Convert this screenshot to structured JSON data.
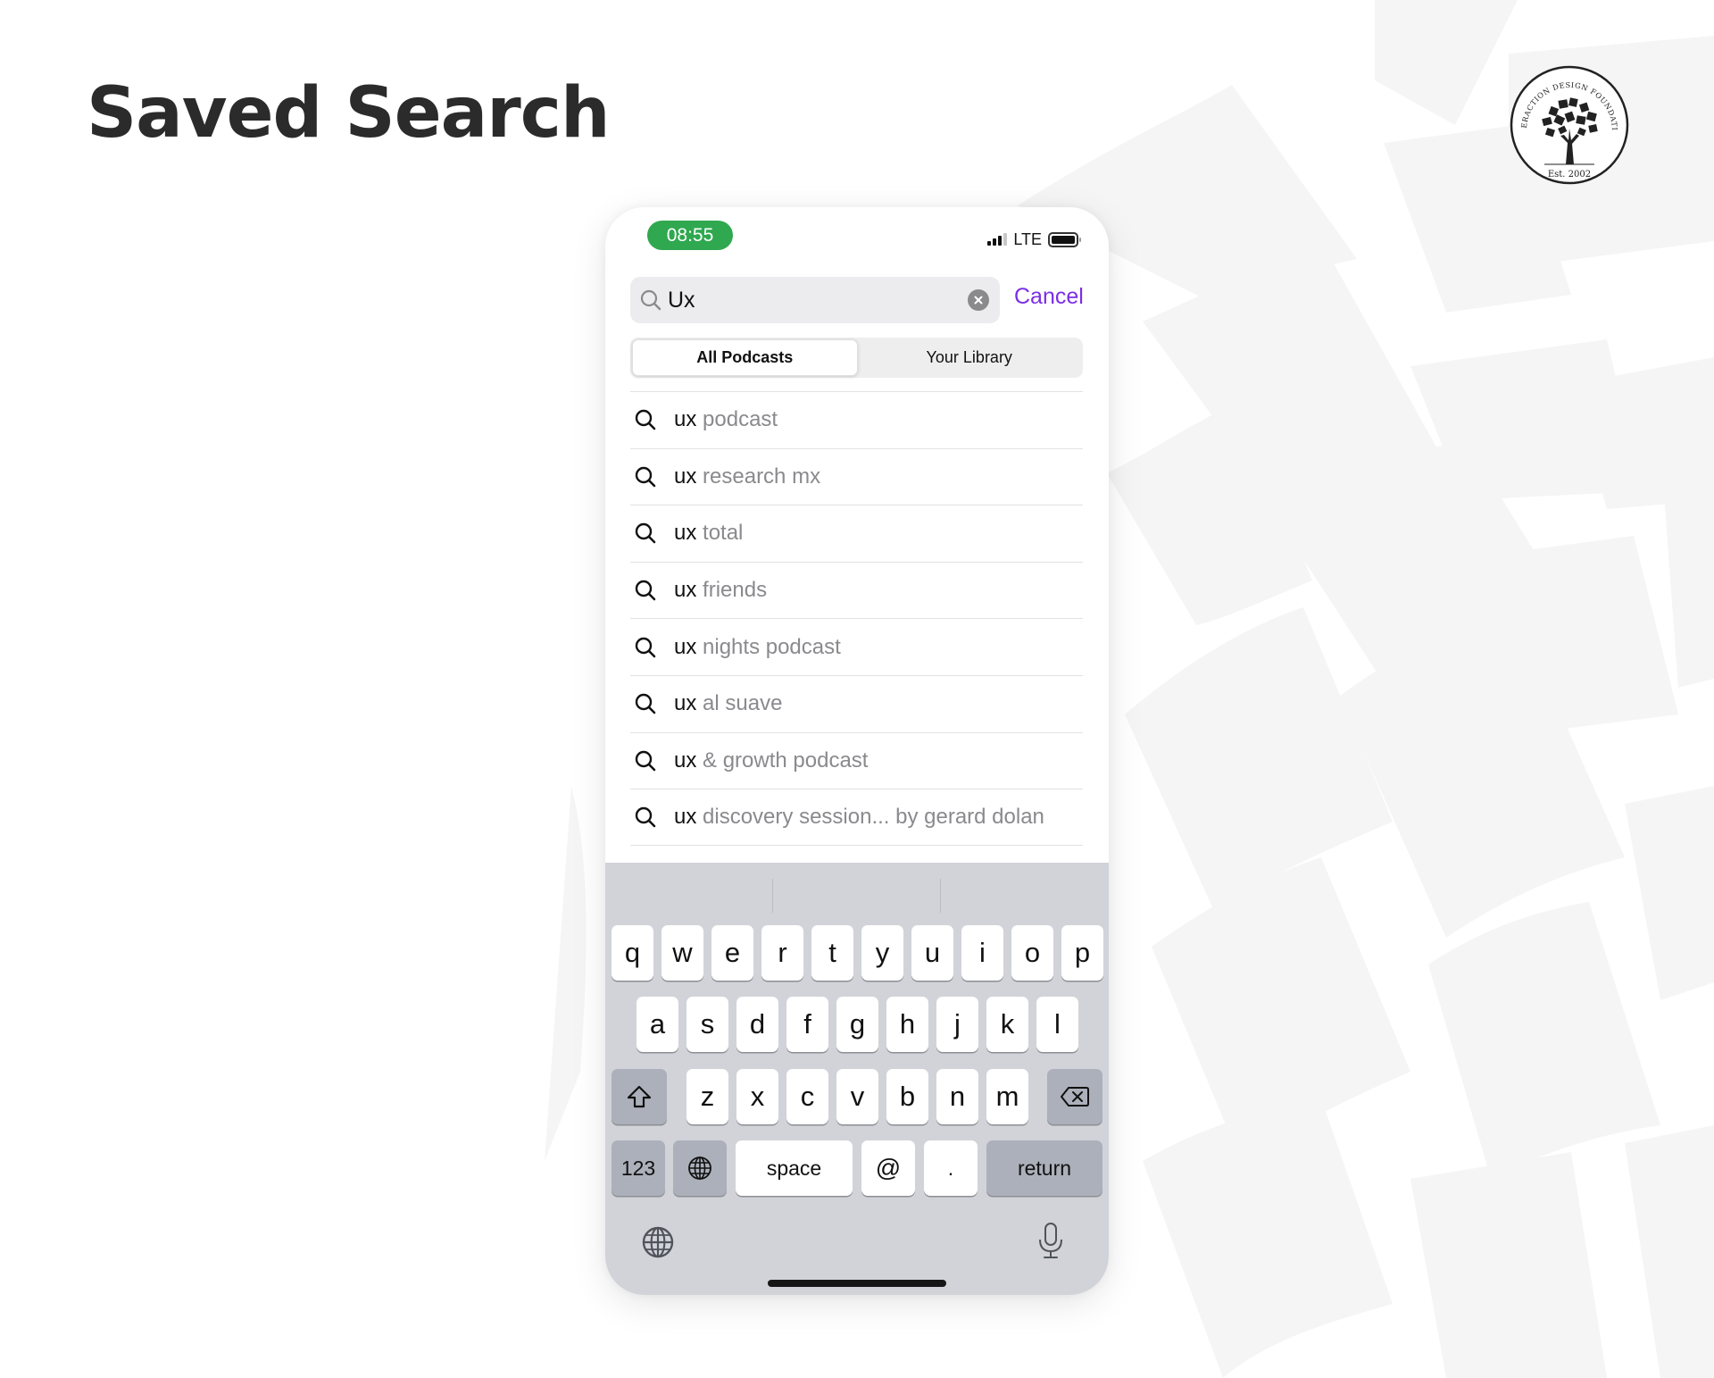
{
  "page": {
    "title": "Saved Search",
    "logo": {
      "ring_text": "INTERACTION DESIGN FOUNDATION",
      "established": "Est. 2002",
      "icon": "tree-of-books-icon"
    }
  },
  "status_bar": {
    "time": "08:55",
    "time_badge_color": "#2fa84f",
    "network": "LTE",
    "signal_bars_filled": 3,
    "signal_bars_total": 4,
    "battery_icon": "battery-icon"
  },
  "search": {
    "value": "Ux",
    "placeholder": "",
    "clear_icon": "clear-icon",
    "cancel_label": "Cancel",
    "accent_color": "#7b2ee6"
  },
  "scope": {
    "tabs": [
      {
        "label": "All Podcasts",
        "selected": true
      },
      {
        "label": "Your Library",
        "selected": false
      }
    ]
  },
  "suggestions": [
    {
      "prefix": "ux",
      "rest": " podcast"
    },
    {
      "prefix": "ux",
      "rest": " research mx"
    },
    {
      "prefix": "ux",
      "rest": " total"
    },
    {
      "prefix": "ux",
      "rest": " friends"
    },
    {
      "prefix": "ux",
      "rest": " nights podcast"
    },
    {
      "prefix": "ux",
      "rest": " al suave"
    },
    {
      "prefix": "ux",
      "rest": " & growth podcast"
    },
    {
      "prefix": "ux",
      "rest": " discovery session... by gerard dolan"
    }
  ],
  "keyboard": {
    "row1": [
      "q",
      "w",
      "e",
      "r",
      "t",
      "y",
      "u",
      "i",
      "o",
      "p"
    ],
    "row2": [
      "a",
      "s",
      "d",
      "f",
      "g",
      "h",
      "j",
      "k",
      "l"
    ],
    "row3": [
      "z",
      "x",
      "c",
      "v",
      "b",
      "n",
      "m"
    ],
    "shift_icon": "shift-icon",
    "delete_icon": "delete-icon",
    "numbers_label": "123",
    "globe_icon": "globe-icon",
    "space_label": "space",
    "at_label": "@",
    "period_label": ".",
    "return_label": "return",
    "dictation_icon": "microphone-icon"
  }
}
